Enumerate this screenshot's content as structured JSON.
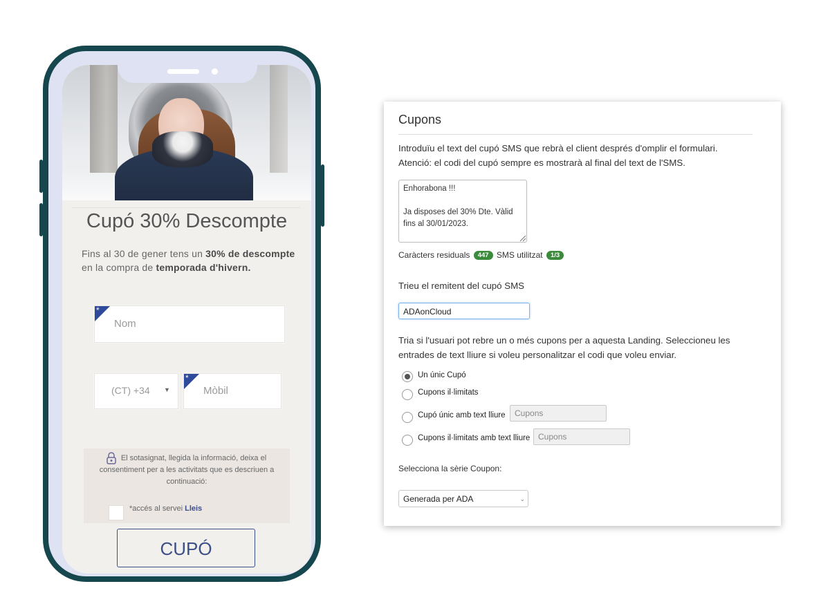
{
  "phone": {
    "coupon_title": "Cupó 30% Descompte",
    "desc_part1": "Fins al 30 de gener tens un ",
    "desc_bold1": "30% de descompte",
    "desc_part2": "en la compra de ",
    "desc_bold2": "temporada d'hivern.",
    "name_placeholder": "Nom",
    "country_code": "(CT) +34",
    "mobile_placeholder": "Mòbil",
    "required_mark": "*",
    "consent_text": "El sotasignat, llegida la informació, deixa el consentiment per a les activitats que es descriuen a continuació:",
    "checkbox_label_prefix": "*accés al servei ",
    "checkbox_label_link": "Lleis",
    "button_label": "CUPÓ"
  },
  "panel": {
    "title": "Cupons",
    "intro_line1": "Introduïu el text del cupó SMS que rebrà el client després d'omplir el formulari.",
    "intro_line2": "Atenció: el codi del cupó sempre es mostrarà al final del text de l'SMS.",
    "sms_text": "Enhorabona !!!\n\nJa disposes del 30% Dte. Vàlid fins al 30/01/2023.",
    "remaining_label": "Caràcters residuals",
    "remaining_count": "447",
    "sms_used_label": "SMS utilitzat",
    "sms_used_count": "1/3",
    "sender_label": "Trieu el remitent del cupó SMS",
    "sender_value": "ADAonCloud",
    "choose_text": "Tria si l'usuari pot rebre un o més cupons per a aquesta Landing. Seleccioneu les entrades de text lliure si voleu personalitzar el codi que voleu enviar.",
    "options": [
      {
        "label": "Un únic Cupó",
        "checked": true
      },
      {
        "label": "Cupons il·limitats",
        "checked": false
      },
      {
        "label": "Cupó únic amb text lliure",
        "checked": false,
        "placeholder": "Cupons"
      },
      {
        "label": "Cupons il·limitats amb text lliure",
        "checked": false,
        "placeholder": "Cupons"
      }
    ],
    "series_label": "Selecciona la sèrie Coupon:",
    "series_value": "Generada per ADA"
  },
  "colors": {
    "phone_frame": "#16474f",
    "accent_blue": "#3c4f86",
    "badge_green": "#3c8a3c"
  }
}
